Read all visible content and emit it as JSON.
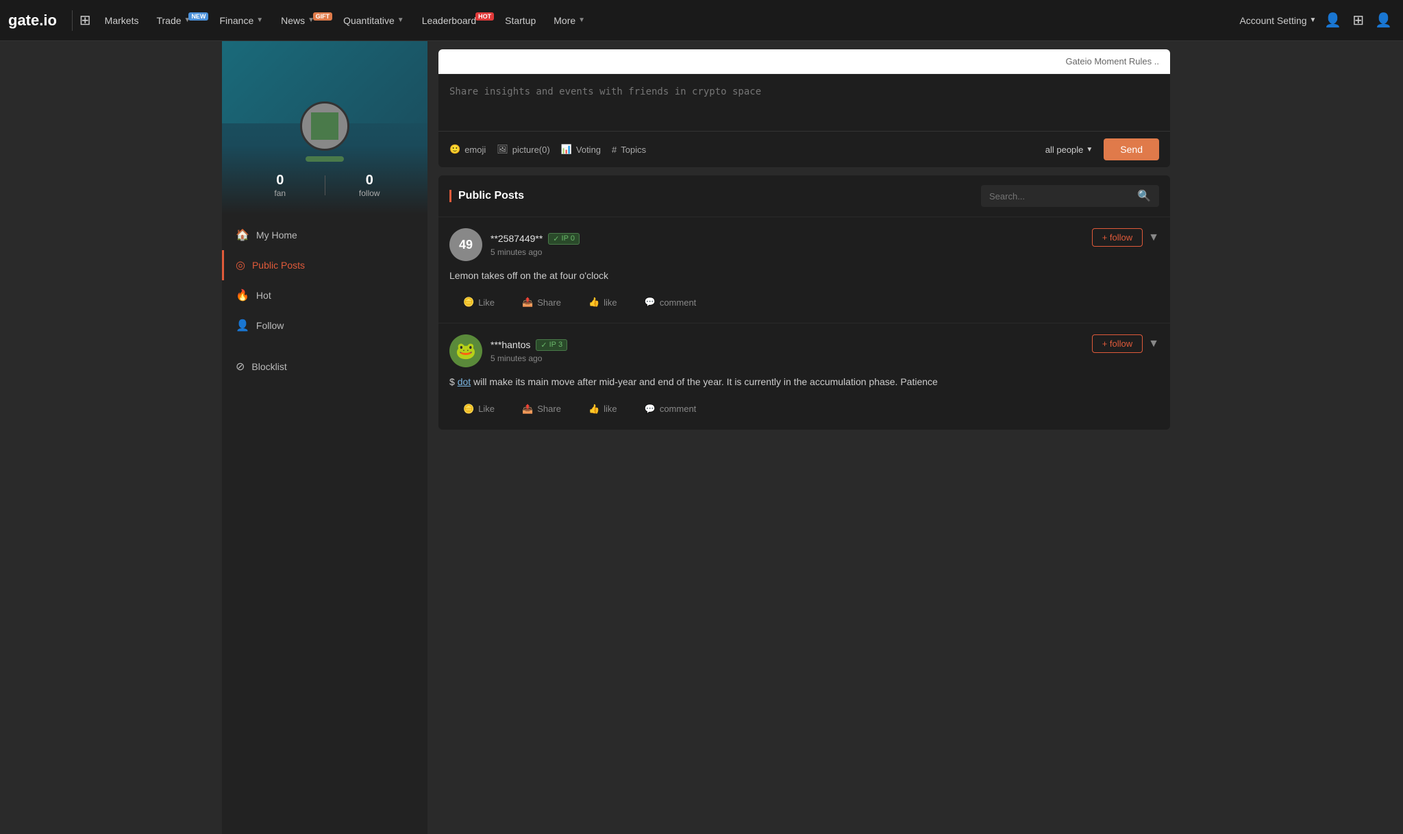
{
  "navbar": {
    "logo": "gate.io",
    "items": [
      {
        "label": "Markets",
        "badge": null
      },
      {
        "label": "Trade",
        "badge": "NEW",
        "badge_type": "new"
      },
      {
        "label": "Finance",
        "badge": null,
        "has_dropdown": true
      },
      {
        "label": "News",
        "badge": "GIFT",
        "badge_type": "gift",
        "has_dropdown": true
      },
      {
        "label": "Quantitative",
        "badge": null,
        "has_dropdown": true
      },
      {
        "label": "Leaderboard",
        "badge": "HOT",
        "badge_type": "hot"
      },
      {
        "label": "Startup",
        "badge": null
      },
      {
        "label": "More",
        "badge": null,
        "has_dropdown": true
      }
    ],
    "account_setting": "Account Setting",
    "icons": [
      "grid-icon",
      "user-circle-icon",
      "qr-icon",
      "user-icon"
    ]
  },
  "sidebar": {
    "profile": {
      "fan_count": "0",
      "fan_label": "fan",
      "follow_count": "0",
      "follow_label": "follow",
      "name_placeholder": ""
    },
    "nav_items": [
      {
        "label": "My Home",
        "icon": "home-icon",
        "active": false
      },
      {
        "label": "Public Posts",
        "icon": "circle-icon",
        "active": true
      },
      {
        "label": "Hot",
        "icon": "fire-icon",
        "active": false
      },
      {
        "label": "Follow",
        "icon": "user-plus-icon",
        "active": false
      },
      {
        "label": "Blocklist",
        "icon": "block-icon",
        "active": false
      }
    ]
  },
  "composer": {
    "rules_text": "Gateio Moment Rules ..",
    "placeholder": "Share insights and events with friends in crypto space",
    "toolbar": {
      "emoji_label": "emoji",
      "picture_label": "picture(0)",
      "voting_label": "Voting",
      "topics_label": "Topics"
    },
    "audience": "all people",
    "send_label": "Send"
  },
  "public_posts": {
    "title": "Public Posts",
    "search_placeholder": "Search...",
    "posts": [
      {
        "id": "post-1",
        "avatar_type": "number",
        "avatar_number": "49",
        "username": "**2587449**",
        "vip_level": "0",
        "time_ago": "5 minutes ago",
        "content": "Lemon takes off on the at four o'clock",
        "like_label": "Like",
        "share_label": "Share",
        "like_action": "like",
        "comment_label": "comment",
        "follow_label": "+ follow"
      },
      {
        "id": "post-2",
        "avatar_type": "frog",
        "avatar_number": "",
        "username": "***hantos",
        "vip_level": "3",
        "time_ago": "5 minutes ago",
        "content_before": "$ ",
        "content_link": "dot",
        "content_after": " will make its main move after mid-year and end of the year. It is currently in the accumulation phase.\nPatience",
        "like_label": "Like",
        "share_label": "Share",
        "like_action": "like",
        "comment_label": "comment",
        "follow_label": "+ follow"
      }
    ]
  }
}
